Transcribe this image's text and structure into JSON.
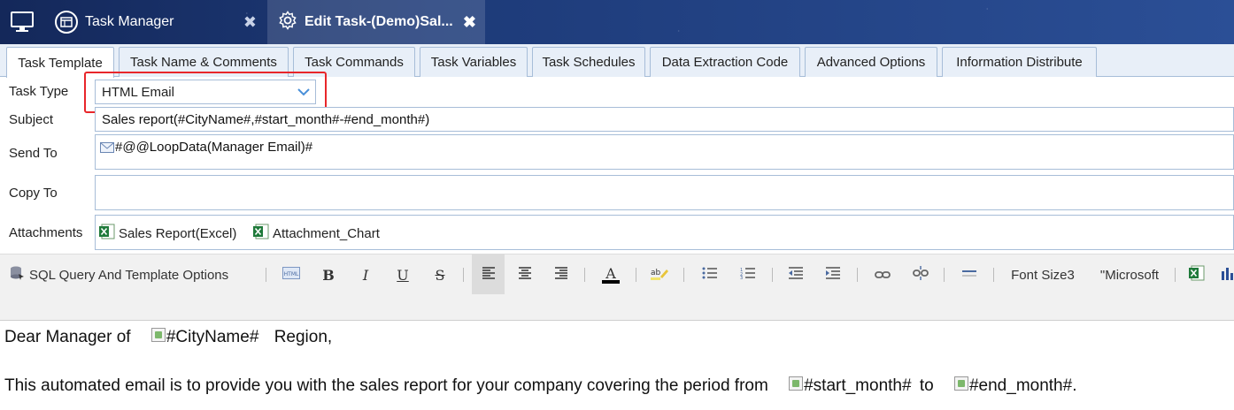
{
  "top_tabs": [
    {
      "label": "Task Manager",
      "close": "✖"
    },
    {
      "label": "Edit Task-(Demo)Sal...",
      "close": "✖"
    }
  ],
  "sub_tabs": [
    "Task Template",
    "Task Name & Comments",
    "Task Commands",
    "Task Variables",
    "Task Schedules",
    "Data Extraction Code",
    "Advanced Options",
    "Information Distribute"
  ],
  "form": {
    "task_type_label": "Task Type",
    "task_type_value": "HTML Email",
    "subject_label": "Subject",
    "subject_value": "Sales report(#CityName#,#start_month#-#end_month#)",
    "send_to_label": "Send To",
    "send_to_value": "#@@LoopData(Manager Email)#",
    "copy_to_label": "Copy To",
    "copy_to_value": "",
    "attachments_label": "Attachments",
    "attachments": [
      "Sales Report(Excel)",
      "Attachment_Chart"
    ]
  },
  "toolbar": {
    "sql_label": "SQL Query And Template Options",
    "bold": "B",
    "italic": "I",
    "underline": "U",
    "strike": "S",
    "font_color": "A",
    "font_size": "Font Size3",
    "font_name": "\"Microsoft"
  },
  "editor": {
    "line1_pre": "Dear Manager of",
    "line1_img": "#CityName#",
    "line1_post": "Region,",
    "line2_pre": "This automated email is to provide you with the sales report for your company covering the period from",
    "line2_img1": "#start_month#",
    "line2_mid": "to",
    "line2_img2": "#end_month#",
    "line2_post": "."
  },
  "colors": {
    "topbar": "#1d3a78",
    "highlight": "#e8262a",
    "tab_border": "#a7bdd8"
  }
}
